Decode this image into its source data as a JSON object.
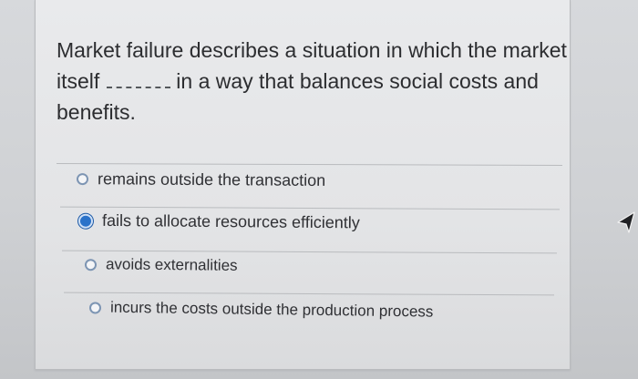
{
  "question": {
    "line1": "Market failure describes a situation in which the market",
    "line2_before": "itself",
    "line2_after": "in a way that balances social costs and",
    "line3": "benefits."
  },
  "options": [
    {
      "label": "remains outside the transaction",
      "selected": false
    },
    {
      "label": "fails to allocate resources efficiently",
      "selected": true
    },
    {
      "label": "avoids externalities",
      "selected": false
    },
    {
      "label": "incurs the costs outside the production process",
      "selected": false
    }
  ],
  "colors": {
    "radio_selected": "#2a72c9",
    "text": "#2c2d30"
  }
}
